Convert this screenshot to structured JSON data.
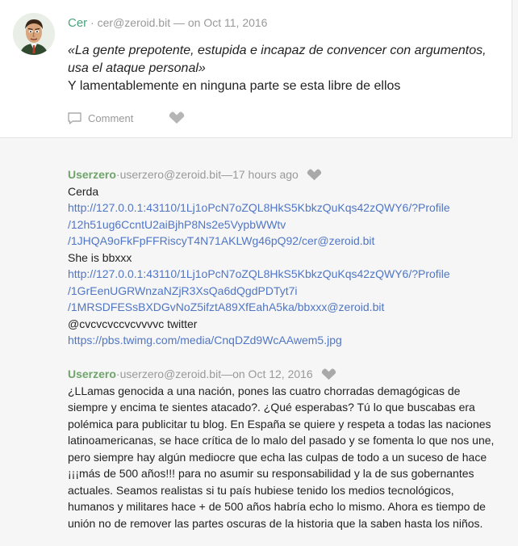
{
  "post": {
    "username": "Cer",
    "email": "cer@zeroid.bit",
    "date": "on Oct 11, 2016",
    "quote": "«La gente prepotente, estupida e incapaz de convencer con argumentos, usa el ataque personal»",
    "text": "Y lamentablemente en ninguna parte se esta libre de ellos",
    "comment_label": "Comment"
  },
  "replies": [
    {
      "username": "Userzero",
      "email": "userzero@zeroid.bit",
      "date": "17 hours ago",
      "lines": [
        {
          "type": "text",
          "value": "Cerda"
        },
        {
          "type": "link",
          "value": "http://127.0.0.1:43110/1Lj1oPcN7oZQL8HkS5KbkzQuKqs42zQWY6/?Profile"
        },
        {
          "type": "link",
          "value": "/12h51ug6CcntU2aiBjhP8Ns2e5VypbWWtv"
        },
        {
          "type": "link",
          "value": "/1JHQA9oFkFpFFRiscyT4N71AKLWg46pQ92/cer@zeroid.bit"
        },
        {
          "type": "text",
          "value": "She is bbxxx"
        },
        {
          "type": "link",
          "value": "http://127.0.0.1:43110/1Lj1oPcN7oZQL8HkS5KbkzQuKqs42zQWY6/?Profile"
        },
        {
          "type": "link",
          "value": "/1GrEenUGRWnzaNZjR3XsQa6dQgdPDTyt7i"
        },
        {
          "type": "link",
          "value": "/1MRSDFESsBXDGvNoZ5ifztA89XfEahA5ka/bbxxx@zeroid.bit"
        },
        {
          "type": "text",
          "value": "@cvcvcvccvcvvvvc twitter"
        },
        {
          "type": "link",
          "value": "https://pbs.twimg.com/media/CnqDZd9WcAAwem5.jpg"
        }
      ]
    },
    {
      "username": "Userzero",
      "email": "userzero@zeroid.bit",
      "date": "on Oct 12, 2016",
      "text": "¿LLamas genocida a una nación, pones las cuatro chorradas demagógicas de siempre y encima te sientes atacado?. ¿Qué esperabas? Tú lo que buscabas era polémica para publicitar tu blog. En España se quiere y respeta a todas las naciones latinoamericanas, se hace crítica de lo malo del pasado y se fomenta lo que nos une, pero siempre hay algún mediocre que echa las culpas de todo a un suceso de hace ¡¡¡más de 500 años!!! para no asumir su responsabilidad y la de sus gobernantes actuales. Seamos realistas si tu país hubiese tenido los medios tecnológicos, humanos y militares hace + de 500 años habría echo lo mismo. Ahora es tiempo de unión no de remover las partes oscuras de la historia que la saben hasta los niños."
    }
  ],
  "separator": " · ",
  "dash": " — ",
  "colors": {
    "username_post": "#4aa57a",
    "username_reply": "#6fa46b",
    "link": "#4f76c6",
    "meta": "#999999"
  }
}
